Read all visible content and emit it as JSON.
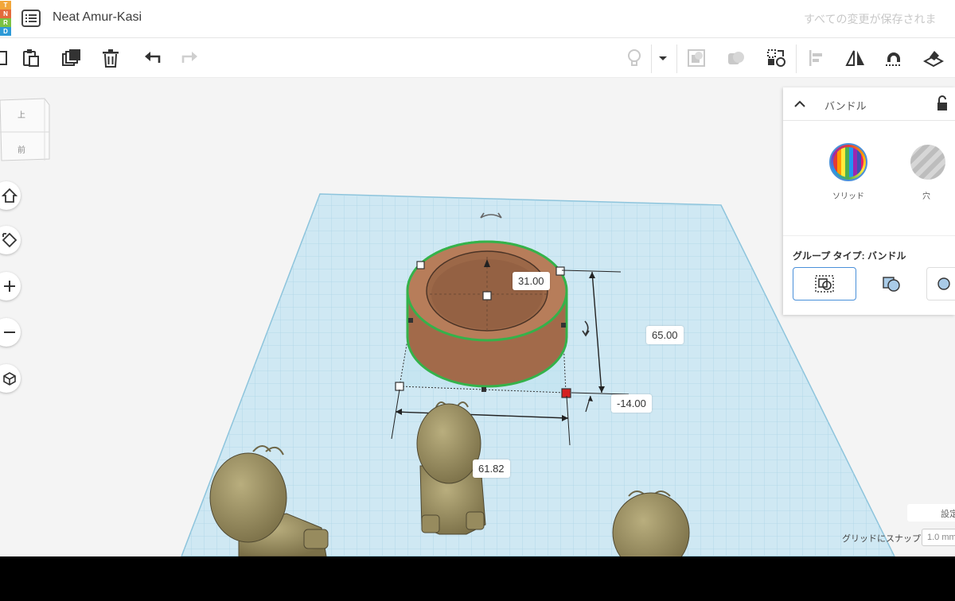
{
  "header": {
    "logo_letters": [
      "T",
      "N",
      "R",
      "D"
    ],
    "document_title": "Neat Amur-Kasi",
    "save_status": "すべての変更が保存されま"
  },
  "viewcube": {
    "top_label": "上",
    "front_label": "前"
  },
  "dimensions": {
    "top_diameter": "31.00",
    "height": "65.00",
    "elevation": "-14.00",
    "width": "61.82"
  },
  "inspector": {
    "title": "バンドル",
    "solid_label": "ソリッド",
    "hole_label": "穴",
    "group_type_label": "グループ タイプ: バンドル"
  },
  "footer": {
    "settings_label": "設定",
    "snap_label": "グリッドにスナップ",
    "snap_value": "1.0 mm"
  },
  "colors": {
    "workplane": "#cfe8f3",
    "grid_line": "#a9d3e6",
    "shape_fill": "#b77d5a",
    "selection_outline": "#35b24a",
    "figure_fill": "#8d8255"
  }
}
